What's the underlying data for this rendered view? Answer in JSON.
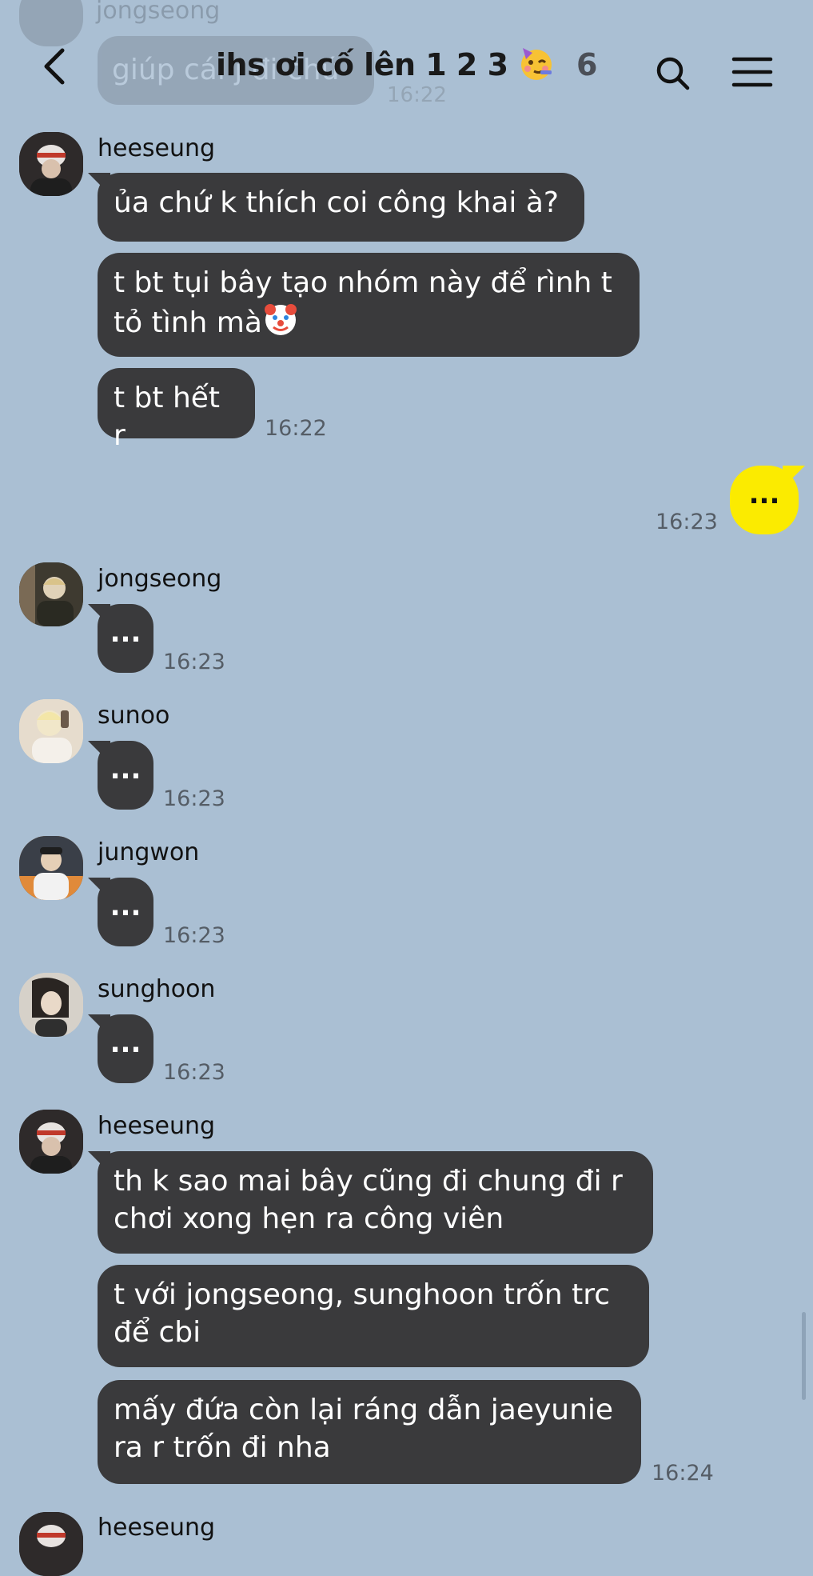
{
  "header": {
    "title": "ihs ơi cố lên 1 2 3",
    "member_count": "6",
    "icons": [
      "back-icon",
      "search-icon",
      "menu-icon",
      "party-face-emoji"
    ]
  },
  "ghost": {
    "name": "jongseong",
    "text": "giúp cái j đi chứ",
    "time": "16:22"
  },
  "messages": [
    {
      "name": "heeseung",
      "bubbles": [
        "ủa chứ k thích coi công khai à?",
        "t bt tụi bây tạo nhóm này để rình t tỏ tình mà",
        "t bt hết r"
      ],
      "time": "16:22"
    },
    {
      "own_text": "...",
      "time": "16:23"
    },
    {
      "name": "jongseong",
      "bubbles": [
        "..."
      ],
      "time": "16:23"
    },
    {
      "name": "sunoo",
      "bubbles": [
        "..."
      ],
      "time": "16:23"
    },
    {
      "name": "jungwon",
      "bubbles": [
        "..."
      ],
      "time": "16:23"
    },
    {
      "name": "sunghoon",
      "bubbles": [
        "..."
      ],
      "time": "16:23"
    },
    {
      "name": "heeseung",
      "bubbles": [
        "th k sao mai bây cũng đi chung đi r chơi xong hẹn ra công viên",
        "t với jongseong, sunghoon trốn trc để cbi",
        "mấy đứa còn lại ráng dẫn jaeyunie ra r trốn đi nha"
      ],
      "time": "16:24"
    },
    {
      "name": "heeseung"
    }
  ],
  "colors": {
    "background": "#aabfd3",
    "bubble": "#3a3a3c",
    "own_bubble": "#fbeb00"
  }
}
